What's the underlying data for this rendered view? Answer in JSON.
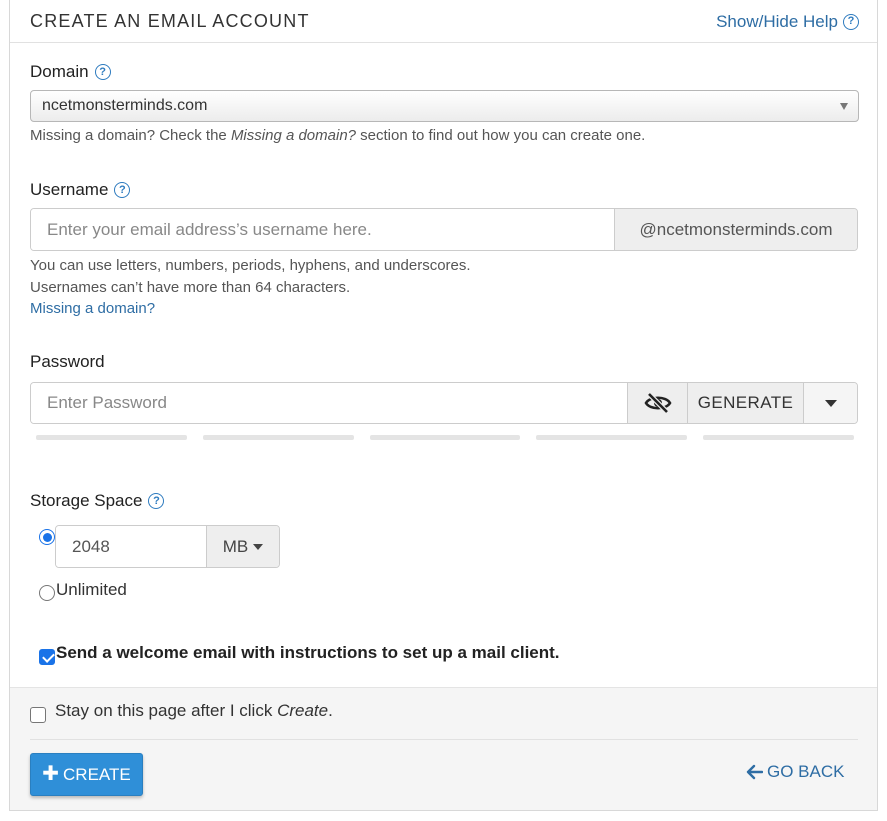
{
  "header": {
    "title": "CREATE AN EMAIL ACCOUNT",
    "help_toggle": "Show/Hide Help"
  },
  "domain": {
    "label": "Domain",
    "selected": "ncetmonsterminds.com",
    "help_prefix": "Missing a domain? Check the ",
    "help_em": "Missing a domain?",
    "help_suffix": " section to find out how you can create one."
  },
  "username": {
    "label": "Username",
    "placeholder": "Enter your email address’s username here.",
    "suffix": "@ncetmonsterminds.com",
    "help_line1": "You can use letters, numbers, periods, hyphens, and underscores.",
    "help_line2": "Usernames can’t have more than 64 characters.",
    "help_link": "Missing a domain?"
  },
  "password": {
    "label": "Password",
    "placeholder": "Enter Password",
    "generate_label": "GENERATE",
    "visibility_icon": "eye-slash-icon",
    "strength_segments": 5
  },
  "storage": {
    "label": "Storage Space",
    "quota_value": "2048",
    "unit": "MB",
    "unlimited_label": "Unlimited",
    "selected_option": "quota"
  },
  "options": {
    "welcome_email_label": "Send a welcome email with instructions to set up a mail client.",
    "welcome_email_checked": true,
    "stay_prefix": "Stay on this page after I click ",
    "stay_em": "Create",
    "stay_suffix": ".",
    "stay_checked": false
  },
  "actions": {
    "create_label": "CREATE",
    "back_label": "GO BACK"
  },
  "colors": {
    "primary_button": "#2f8fd8",
    "link": "#2e6da4",
    "checkbox_accent": "#1a73e8"
  }
}
